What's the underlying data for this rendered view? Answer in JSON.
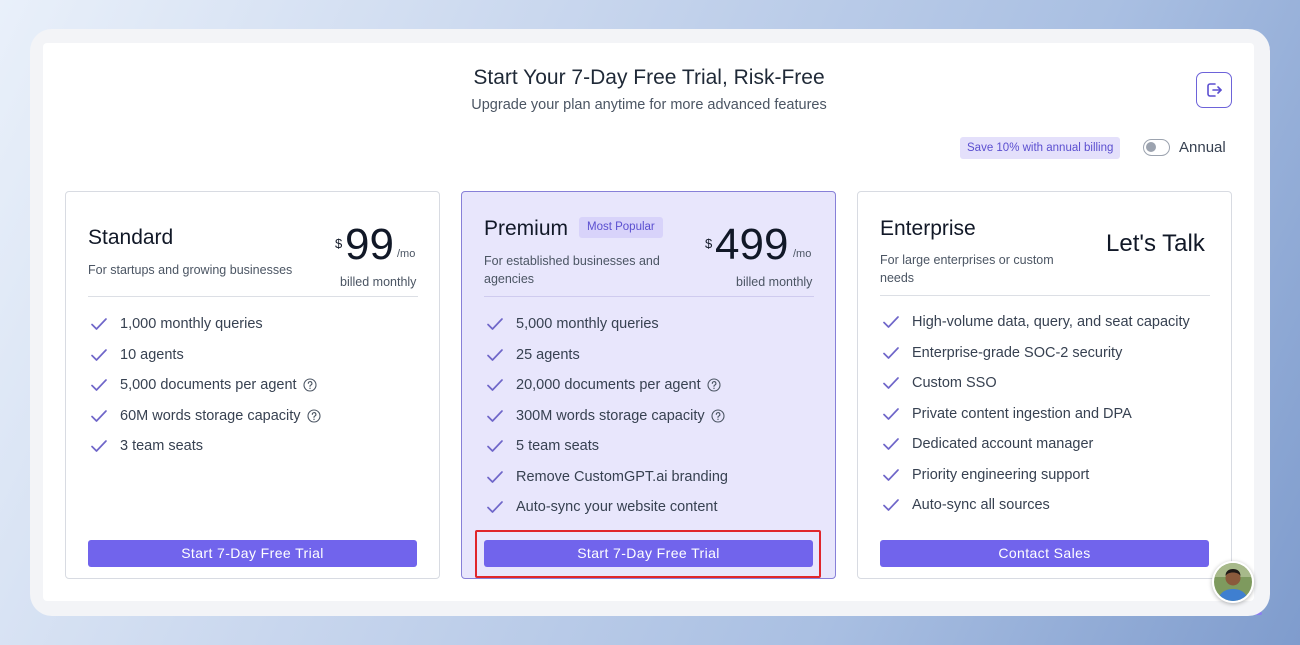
{
  "header": {
    "title": "Start Your 7-Day Free Trial, Risk-Free",
    "subtitle": "Upgrade your plan anytime for more advanced features",
    "logout_icon": "logout-icon"
  },
  "billing": {
    "save_badge": "Save 10% with annual billing",
    "toggle_label": "Annual",
    "annual_enabled": false
  },
  "plans": [
    {
      "name": "Standard",
      "description": "For startups and growing businesses",
      "currency": "$",
      "price": "99",
      "period": "/mo",
      "billed": "billed monthly",
      "features": [
        {
          "text": "1,000 monthly queries",
          "help": false
        },
        {
          "text": "10 agents",
          "help": false
        },
        {
          "text": "5,000 documents per agent",
          "help": true
        },
        {
          "text": "60M words storage capacity",
          "help": true
        },
        {
          "text": "3 team seats",
          "help": false
        }
      ],
      "cta": "Start 7-Day Free Trial"
    },
    {
      "name": "Premium",
      "badge": "Most Popular",
      "description": "For established businesses and agencies",
      "currency": "$",
      "price": "499",
      "period": "/mo",
      "billed": "billed monthly",
      "features": [
        {
          "text": "5,000 monthly queries",
          "help": false
        },
        {
          "text": "25 agents",
          "help": false
        },
        {
          "text": "20,000 documents per agent",
          "help": true
        },
        {
          "text": "300M words storage capacity",
          "help": true
        },
        {
          "text": "5 team seats",
          "help": false
        },
        {
          "text": "Remove CustomGPT.ai branding",
          "help": false
        },
        {
          "text": "Auto-sync your website content",
          "help": false
        }
      ],
      "cta": "Start 7-Day Free Trial"
    },
    {
      "name": "Enterprise",
      "description": "For large enterprises or custom needs",
      "price_text": "Let's Talk",
      "features": [
        {
          "text": "High-volume data, query, and seat capacity",
          "help": false
        },
        {
          "text": "Enterprise-grade SOC-2 security",
          "help": false
        },
        {
          "text": "Custom SSO",
          "help": false
        },
        {
          "text": "Private content ingestion and DPA",
          "help": false
        },
        {
          "text": "Dedicated account manager",
          "help": false
        },
        {
          "text": "Priority engineering support",
          "help": false
        },
        {
          "text": "Auto-sync all sources",
          "help": false
        }
      ],
      "cta": "Contact Sales"
    }
  ],
  "colors": {
    "accent": "#7164ec",
    "badge_bg": "#e4e0fb",
    "premium_bg": "#e8e6fc",
    "highlight": "#e0262b"
  },
  "icons": {
    "feature_check": "check-icon",
    "feature_help": "help-circle-icon",
    "support_avatar": "avatar"
  }
}
